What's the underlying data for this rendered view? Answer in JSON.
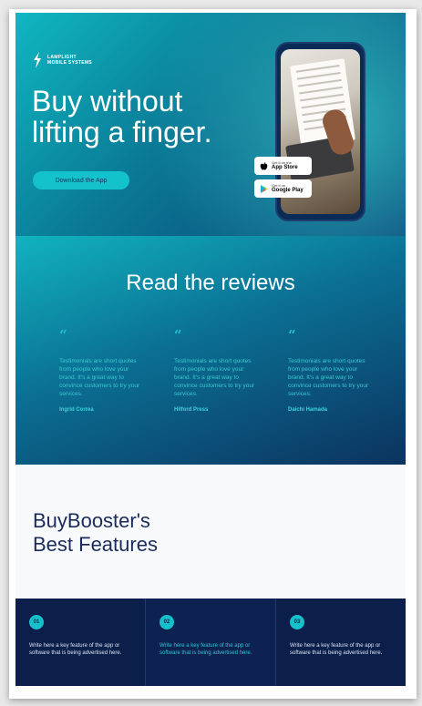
{
  "hero": {
    "logo_line1": "LAMPLIGHT",
    "logo_line2": "MOBILE SYSTEMS",
    "title_line1": "Buy without",
    "title_line2": "lifting a finger.",
    "cta_label": "Download the App",
    "appstore_small": "Get it on the",
    "appstore_big": "App Store",
    "gplay_small": "Get it on",
    "gplay_big": "Google Play"
  },
  "reviews": {
    "title": "Read the reviews",
    "quote_glyph": "“",
    "items": [
      {
        "text": "Testimonials are short quotes from people who love your brand. It's a great way to convince customers to try your services.",
        "name": "Ingrid Correa"
      },
      {
        "text": "Testimonials are short quotes from people who love your brand. It's a great way to convince customers to try your services.",
        "name": "Hilford Press"
      },
      {
        "text": "Testimonials are short quotes from people who love your brand. It's a great way to convince customers to try your services.",
        "name": "Daichi Hamada"
      }
    ]
  },
  "features": {
    "title_line1": "BuyBooster's",
    "title_line2": "Best Features",
    "items": [
      {
        "num": "01",
        "text": "Write here a key feature of the app or software that is being advertised here."
      },
      {
        "num": "02",
        "text": "Write here a key feature of the app or software that is being advertised here."
      },
      {
        "num": "03",
        "text": "Write here a key feature of the app or software that is being advertised here."
      }
    ]
  },
  "colors": {
    "teal": "#14c2cb",
    "navy": "#0c1f4a",
    "title_navy": "#1b2c5c"
  },
  "icons": [
    "bolt-logo-icon",
    "apple-icon",
    "google-play-icon",
    "quote-icon"
  ]
}
